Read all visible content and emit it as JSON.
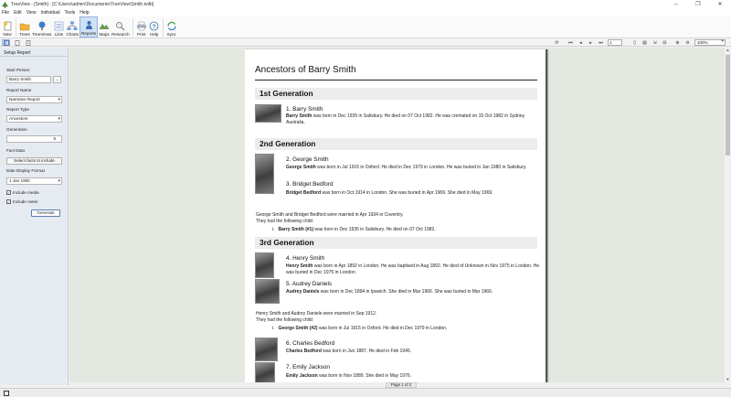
{
  "window": {
    "title": "TreeView - [Smith] - [C:\\Users\\admin\\Documents\\TreeView\\Smith.tvdb]",
    "controls": [
      "–",
      "❐",
      "✕"
    ]
  },
  "menu": [
    "File",
    "Edit",
    "View",
    "Individual",
    "Tools",
    "Help"
  ],
  "ribbon": [
    {
      "label": "New",
      "icon": "new-file-icon"
    },
    {
      "label": "Trees",
      "icon": "trees-folder-icon"
    },
    {
      "label": "TreeViews",
      "icon": "treeviews-icon"
    },
    {
      "label": "Lists",
      "icon": "lists-icon"
    },
    {
      "label": "Charts",
      "icon": "charts-icon"
    },
    {
      "label": "Reports",
      "icon": "reports-icon"
    },
    {
      "label": "Maps",
      "icon": "maps-icon"
    },
    {
      "label": "Research",
      "icon": "research-icon"
    },
    {
      "label": "Print",
      "icon": "print-icon"
    },
    {
      "label": "Help",
      "icon": "help-icon"
    },
    {
      "label": "Sync",
      "icon": "sync-icon"
    }
  ],
  "toolbar2": {
    "page_value": "1",
    "zoom_value": "100%"
  },
  "setup": {
    "header": "Setup Report",
    "start_person_label": "Start Person",
    "start_person_value": "Barry Smith",
    "browse_label": "...",
    "report_name_label": "Report Name",
    "report_name_value": "Narrative Report",
    "report_type_label": "Report Type",
    "report_type_value": "Ancestors",
    "generation_label": "Generation",
    "generation_value": "6",
    "fact_data_label": "Fact Data",
    "select_facts_label": "Select facts to include",
    "date_format_label": "Date Display Format",
    "date_format_value": "1 Jan 1900",
    "include_media_label": "Include media",
    "include_notes_label": "Include notes",
    "generate_label": "Generate"
  },
  "report": {
    "title": "Ancestors of Barry Smith",
    "gen1": "1st Generation",
    "gen2": "2nd Generation",
    "gen3": "3rd Generation",
    "p1": {
      "name": "1. Barry Smith",
      "bold": "Barry Smith",
      "text": " was born in Dec 1935 in Salisbury. He died on 07 Oct 1982. He was cremated on 15 Oct 1982 in Sydney Australia."
    },
    "p2": {
      "name": "2. George Smith",
      "bold": "George Smith",
      "text": " was born in Jul 1915 in Oxford. He died in Dec 1979 in London. He was buried in Jan 1980 in Salisbury."
    },
    "p3": {
      "name": "3. Bridget Bedford",
      "bold": "Bridget Bedford",
      "text": " was born in Oct 1914 in London. She was buried in Apr 1969. She died in May 1969."
    },
    "m1": {
      "line1": "George Smith and Bridget Bedford were married in Apr 1934 in Coventry.",
      "line2": "They had the following child:",
      "child_num": "i.",
      "child_bold": "Barry Smith (#1)",
      "child_text": " was born in Dec 1935 in Salisbury. He died on 07 Oct 1982."
    },
    "p4": {
      "name": "4. Henry Smith",
      "bold": "Henry Smith",
      "text": " was born in Apr 1892 in London. He was baptised in Aug 1892. He died of Unknown in Nov 1975 in London. He was buried in Dec 1975 in London."
    },
    "p5": {
      "name": "5. Audrey Daniels",
      "bold": "Audrey Daniels",
      "text": " was born in Dec 1894 in Ipswich. She died in Mar 1966. She was buried in Mar 1966."
    },
    "m2": {
      "line1": "Henry Smith and Audrey Daniels were married in Sep 1912.",
      "line2": "They had the following child:",
      "child_num": "i.",
      "child_bold": "George Smith (#2)",
      "child_text": " was born in Jul 1915 in Oxford. He died in Dec 1979 in London."
    },
    "p6": {
      "name": "6. Charles Bedford",
      "bold": "Charles Bedford",
      "text": " was born in Jun 1887. He died in Feb 1945."
    },
    "p7": {
      "name": "7. Emily Jackson",
      "bold": "Emily Jackson",
      "text": " was born in Nov 1889. She died in May 1976."
    }
  },
  "page_indicator": "Page 1 of 2"
}
